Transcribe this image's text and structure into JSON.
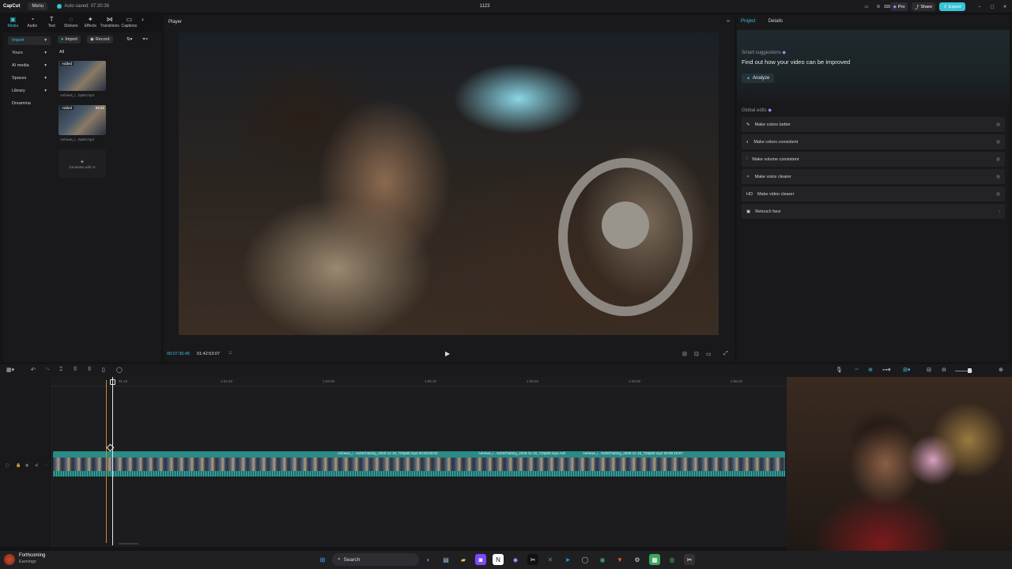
{
  "titlebar": {
    "app_name": "CapCut",
    "menu_label": "Menu",
    "autosave": "Auto saved: 07:30:36",
    "project_title": "1123",
    "pro_label": "Pro",
    "share_label": "Share",
    "export_label": "Export"
  },
  "tool_tabs": [
    {
      "label": "Media",
      "icon": "▣"
    },
    {
      "label": "Audio",
      "icon": "◔"
    },
    {
      "label": "Text",
      "icon": "T"
    },
    {
      "label": "Stickers",
      "icon": "◌"
    },
    {
      "label": "Effects",
      "icon": "✦"
    },
    {
      "label": "Transitions",
      "icon": "⋈"
    },
    {
      "label": "Captions",
      "icon": "▭"
    }
  ],
  "media_nav": [
    {
      "label": "Import",
      "arrow": "▾"
    },
    {
      "label": "Yours",
      "arrow": "▾"
    },
    {
      "label": "AI media",
      "arrow": "▾"
    },
    {
      "label": "Spaces",
      "arrow": "▾"
    },
    {
      "label": "Library",
      "arrow": "▾"
    },
    {
      "label": "Dreamina",
      "arrow": ""
    }
  ],
  "media_toolbar": {
    "import_label": "Import",
    "record_label": "Record",
    "filter_all": "All"
  },
  "media_items": [
    {
      "badge": "Added",
      "duration": "",
      "filename": "Ashews_i...0p60.mp4"
    },
    {
      "badge": "Added",
      "duration": "08:41",
      "filename": "Ashews_i...0p60.mp4"
    }
  ],
  "generate_label": "Generate with AI",
  "player": {
    "header": "Player",
    "current_time": "00:07:36:45",
    "total_time": "01:42:53:07"
  },
  "right_panel": {
    "tab_project": "Project",
    "tab_details": "Details",
    "smart_title": "Smart suggestions",
    "smart_headline": "Find out how your video can be improved",
    "analyze_label": "Analyze",
    "global_title": "Global edits",
    "edits": [
      {
        "label": "Make colors better",
        "icon": "✎"
      },
      {
        "label": "Make colors consistent",
        "icon": "◐"
      },
      {
        "label": "Make volume consistent",
        "icon": "⫶"
      },
      {
        "label": "Make voice clearer",
        "icon": "✧"
      },
      {
        "label": "Make video clearer",
        "icon": "HD"
      },
      {
        "label": "Retouch face",
        "icon": "▣"
      }
    ]
  },
  "timeline": {
    "ticks": [
      "01:10",
      "1:01:20",
      "1:03:00",
      "1:06:10",
      "1:06:20",
      "1:08:30",
      "1:08:40"
    ],
    "clip_labels": [
      "Ashews_i...%20Chatting_2025-11-19_720p60.mp4   00:03:53:03",
      "Ashews_i...%20Chatting_2025-11-19_720p60.mp4   Ash",
      "Ashews_i...%20Chatting_2025-11-19_720p60.mp4   00:00:19:57"
    ]
  },
  "taskbar": {
    "weather_title": "Forthcoming",
    "weather_sub": "Earnings",
    "search_label": "Search"
  },
  "colors": {
    "accent": "#38c3d6",
    "clip": "#2a8a86",
    "panel": "#19191c"
  }
}
